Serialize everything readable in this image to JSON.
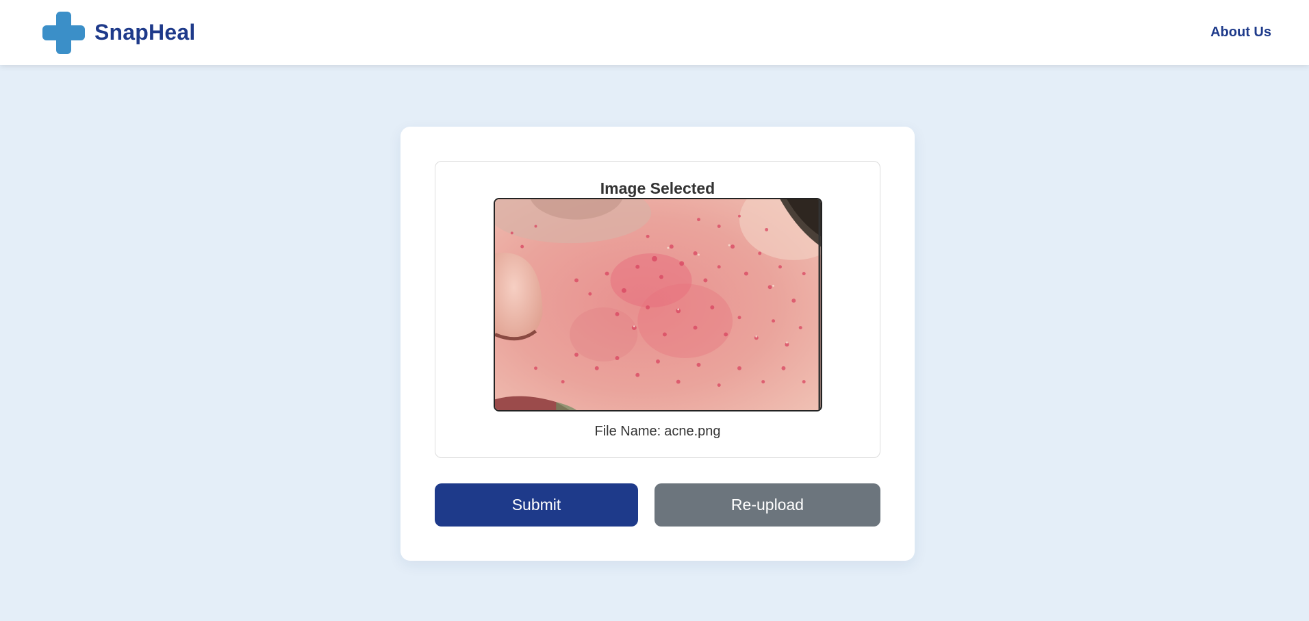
{
  "header": {
    "brand_name": "SnapHeal",
    "about_link": "About Us"
  },
  "preview": {
    "title": "Image Selected",
    "image_icon": "skin-photo-image",
    "file_name_label": "File Name:",
    "file_name": "acne.png"
  },
  "actions": {
    "submit_label": "Submit",
    "reupload_label": "Re-upload"
  },
  "colors": {
    "brand_navy": "#1e3a8a",
    "logo_blue": "#3b8fc8",
    "reupload_gray": "#6c757d",
    "page_background": "#e4eef8"
  }
}
